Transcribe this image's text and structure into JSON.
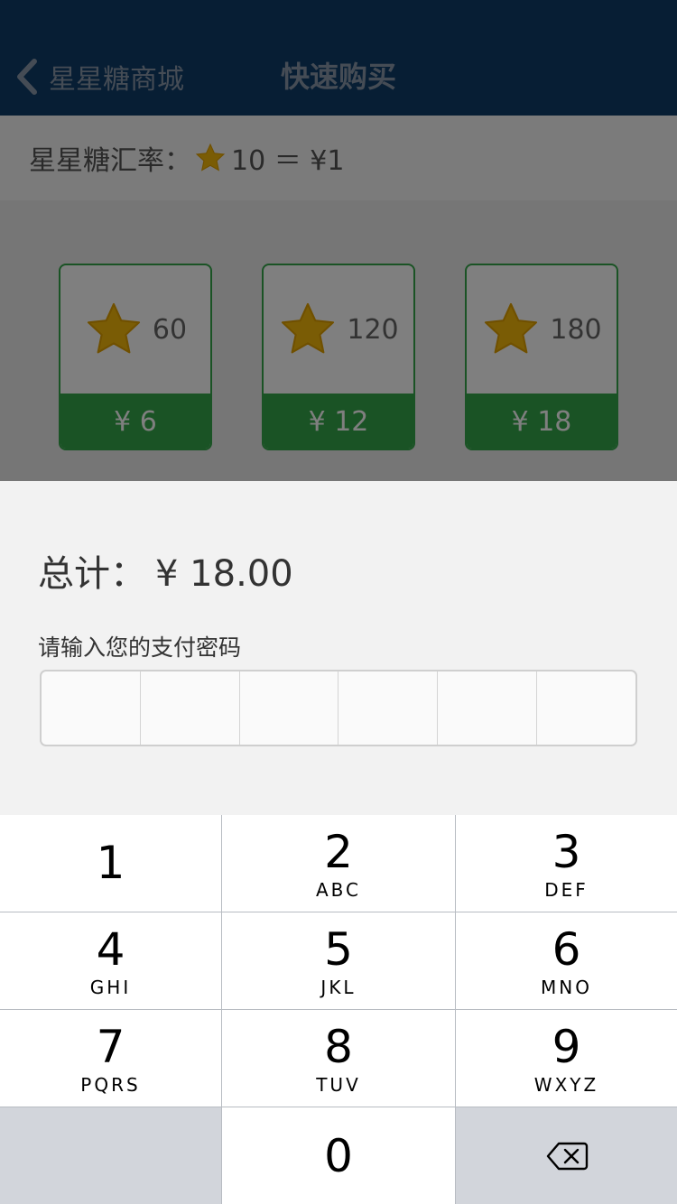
{
  "navbar": {
    "back_label": "星星糖商城",
    "title": "快速购买"
  },
  "rate": {
    "label": "星星糖汇率：",
    "value": "10 ＝ ¥1"
  },
  "packages": [
    {
      "amount": "60",
      "price": "¥ 6"
    },
    {
      "amount": "120",
      "price": "¥ 12"
    },
    {
      "amount": "180",
      "price": "¥ 18"
    }
  ],
  "payment": {
    "total_label": "总计：",
    "total_value": "¥ 18.00",
    "password_label": "请输入您的支付密码",
    "password_cells": 6
  },
  "keypad": [
    {
      "num": "1",
      "letters": ""
    },
    {
      "num": "2",
      "letters": "ABC"
    },
    {
      "num": "3",
      "letters": "DEF"
    },
    {
      "num": "4",
      "letters": "GHI"
    },
    {
      "num": "5",
      "letters": "JKL"
    },
    {
      "num": "6",
      "letters": "MNO"
    },
    {
      "num": "7",
      "letters": "PQRS"
    },
    {
      "num": "8",
      "letters": "TUV"
    },
    {
      "num": "9",
      "letters": "WXYZ"
    },
    {
      "num": "0",
      "letters": ""
    }
  ],
  "colors": {
    "navbar": "#0f3c68",
    "accent_green": "#35a64a",
    "star": "#f5b90a"
  },
  "icons": {
    "back": "chevron-left-icon",
    "star": "star-icon",
    "delete": "backspace-icon"
  }
}
